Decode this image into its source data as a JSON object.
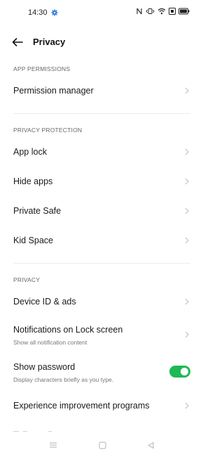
{
  "status_bar": {
    "time": "14:30",
    "icons": [
      "nfc-icon",
      "vibrate-icon",
      "wifi-icon",
      "data-icon",
      "battery-icon"
    ]
  },
  "header": {
    "title": "Privacy"
  },
  "sections": {
    "app_permissions": {
      "header": "APP PERMISSIONS",
      "items": [
        {
          "label": "Permission manager"
        }
      ]
    },
    "privacy_protection": {
      "header": "PRIVACY PROTECTION",
      "items": [
        {
          "label": "App lock"
        },
        {
          "label": "Hide apps"
        },
        {
          "label": "Private Safe"
        },
        {
          "label": "Kid Space"
        }
      ]
    },
    "privacy": {
      "header": "PRIVACY",
      "items": [
        {
          "label": "Device ID & ads"
        },
        {
          "label": "Notifications on Lock screen",
          "subtitle": "Show all notification content"
        },
        {
          "label": "Show password",
          "subtitle": "Display characters briefly as you type.",
          "toggle_on": true
        },
        {
          "label": "Experience improvement programs"
        }
      ]
    }
  },
  "colors": {
    "accent": "#1db954",
    "status_gear": "#2f7de1"
  },
  "nav_icons": [
    "menu-icon",
    "home-icon",
    "back-triangle-icon"
  ]
}
